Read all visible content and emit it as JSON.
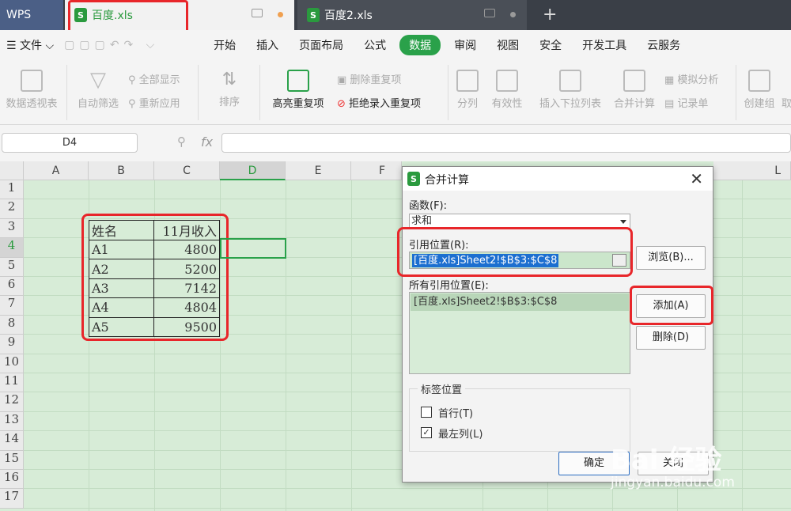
{
  "app": {
    "logo": "WPS"
  },
  "tabs": [
    {
      "label": "百度.xls",
      "dot_color": "#f0a050"
    },
    {
      "label": "百度2.xls",
      "dot_color": "#9a9a9a"
    }
  ],
  "menu": {
    "file": "文件",
    "items": [
      "开始",
      "插入",
      "页面布局",
      "公式",
      "数据",
      "审阅",
      "视图",
      "安全",
      "开发工具",
      "云服务"
    ],
    "active": "数据"
  },
  "ribbon": {
    "pivot": "数据透视表",
    "autofilter": "自动筛选",
    "show_all": "全部显示",
    "reapply": "重新应用",
    "sort": "排序",
    "highlight_dup": "高亮重复项",
    "delete_dup": "删除重复项",
    "reject_dup": "拒绝录入重复项",
    "split": "分列",
    "validity": "有效性",
    "insert_dropdown": "插入下拉列表",
    "consolidate": "合并计算",
    "simulate": "模拟分析",
    "record": "记录单",
    "create_group": "创建组",
    "cancel_group": "取"
  },
  "formula_bar": {
    "cell_ref": "D4",
    "fx": "fx",
    "value": ""
  },
  "columns": [
    "A",
    "B",
    "C",
    "D",
    "E",
    "F",
    "L"
  ],
  "selected_column": "D",
  "rows": [
    "1",
    "2",
    "3",
    "4",
    "5",
    "6",
    "7",
    "8",
    "9",
    "10",
    "11",
    "12",
    "13",
    "14",
    "15",
    "16",
    "17"
  ],
  "selected_row": "4",
  "table": {
    "header": [
      "姓名",
      "11月收入"
    ],
    "rows": [
      [
        "A1",
        "4800"
      ],
      [
        "A2",
        "5200"
      ],
      [
        "A3",
        "7142"
      ],
      [
        "A4",
        "4804"
      ],
      [
        "A5",
        "9500"
      ]
    ]
  },
  "dialog": {
    "title": "合并计算",
    "function_label": "函数(F):",
    "function_value": "求和",
    "ref_label": "引用位置(R):",
    "ref_value": "[百度.xls]Sheet2!$B$3:$C$8",
    "browse": "浏览(B)...",
    "all_refs_label": "所有引用位置(E):",
    "all_refs": [
      "[百度.xls]Sheet2!$B$3:$C$8"
    ],
    "add": "添加(A)",
    "delete": "删除(D)",
    "label_position": "标签位置",
    "first_row": "首行(T)",
    "first_row_checked": false,
    "leftmost_col": "最左列(L)",
    "leftmost_col_checked": true,
    "ok": "确定",
    "close": "关闭"
  },
  "watermark": {
    "brand": "Bai 经验",
    "url": "jingyan.baidu.com"
  }
}
